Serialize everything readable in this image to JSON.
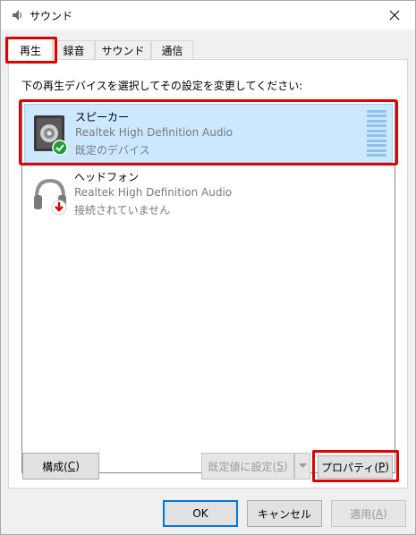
{
  "window": {
    "title": "サウンド"
  },
  "tabs": [
    {
      "label": "再生",
      "active": true
    },
    {
      "label": "録音",
      "active": false
    },
    {
      "label": "サウンド",
      "active": false
    },
    {
      "label": "通信",
      "active": false
    }
  ],
  "instruction": "下の再生デバイスを選択してその設定を変更してください:",
  "devices": [
    {
      "name": "スピーカー",
      "driver": "Realtek High Definition Audio",
      "status": "既定のデバイス",
      "icon": "speaker-icon",
      "badge": "green-check-icon",
      "selected": true
    },
    {
      "name": "ヘッドフォン",
      "driver": "Realtek High Definition Audio",
      "status": "接続されていません",
      "icon": "headphones-icon",
      "badge": "red-down-arrow-icon",
      "selected": false
    }
  ],
  "buttons": {
    "configure": {
      "text": "構成(",
      "key": "C",
      "end": ")"
    },
    "set_default": {
      "text": "既定値に設定(",
      "key": "S",
      "end": ")"
    },
    "properties": {
      "text": "プロパティ(",
      "key": "P",
      "end": ")"
    },
    "ok": "OK",
    "cancel": "キャンセル",
    "apply": {
      "text": "適用(",
      "key": "A",
      "end": ")"
    }
  },
  "colors": {
    "selection_bg": "#cce8ff",
    "highlight_red": "#e00000",
    "default_button_border": "#0078d7"
  }
}
